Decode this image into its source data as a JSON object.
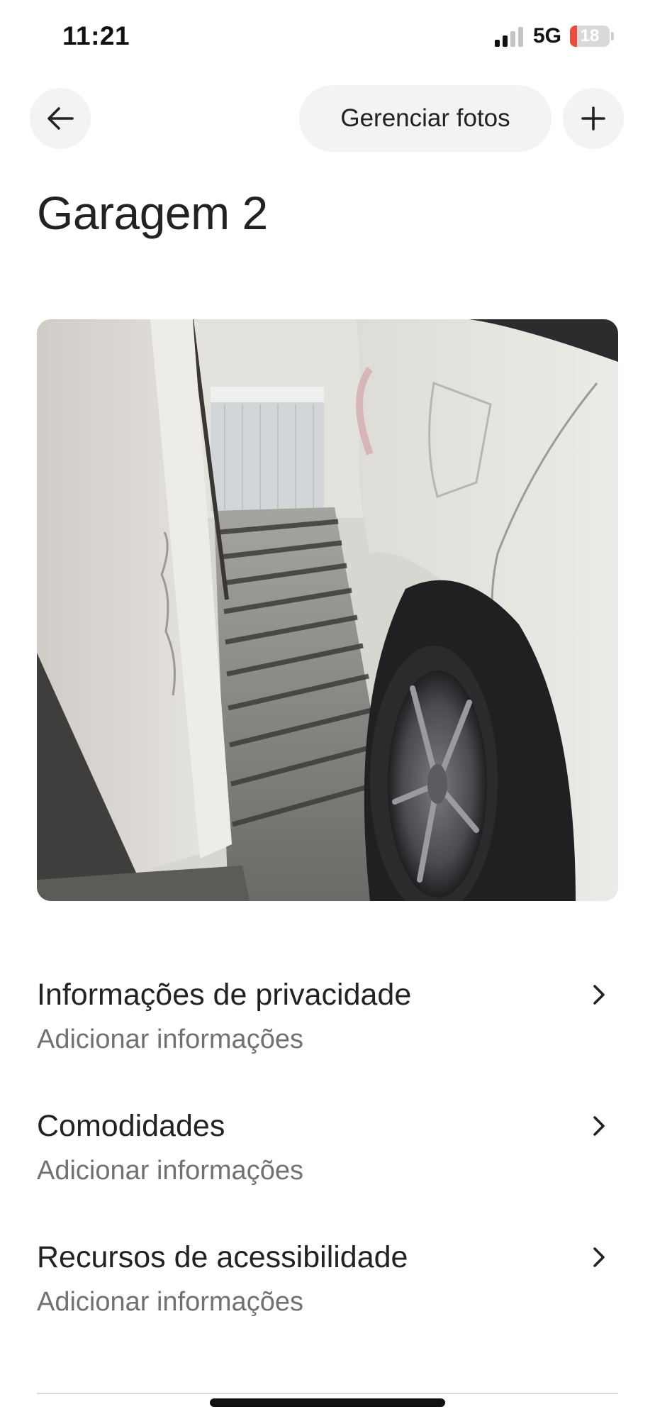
{
  "status_bar": {
    "time": "11:21",
    "network": "5G",
    "battery_percent": "18"
  },
  "nav": {
    "back_icon": "arrow-left-icon",
    "manage_photos_label": "Gerenciar fotos",
    "add_icon": "plus-icon"
  },
  "page": {
    "title": "Garagem 2"
  },
  "photo": {
    "content": "garage-photo"
  },
  "sections": [
    {
      "title": "Informações de privacidade",
      "subtitle": "Adicionar informações"
    },
    {
      "title": "Comodidades",
      "subtitle": "Adicionar informações"
    },
    {
      "title": "Recursos de acessibilidade",
      "subtitle": "Adicionar informações"
    }
  ],
  "colors": {
    "text_primary": "#222222",
    "text_secondary": "#717171",
    "button_bg": "#f3f3f3",
    "battery_low": "#eb4d3d",
    "divider": "#dddddd"
  }
}
